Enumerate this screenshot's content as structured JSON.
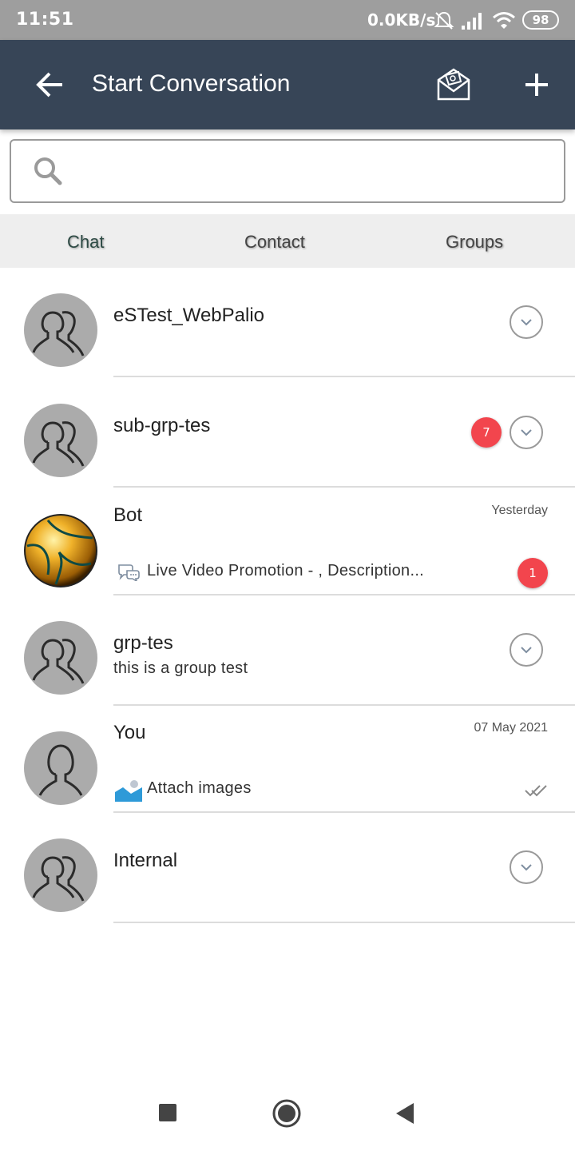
{
  "status_bar": {
    "time": "11:51",
    "network_speed": "0.0KB/s",
    "battery": "98",
    "icons": [
      "alarm-off-icon",
      "signal-icon",
      "wifi-icon",
      "battery-icon"
    ]
  },
  "app_bar": {
    "title": "Start Conversation",
    "background": "#374557",
    "icons": [
      "back-arrow-icon",
      "broadcast-mail-icon",
      "plus-icon"
    ]
  },
  "search": {
    "placeholder": "",
    "value": ""
  },
  "tabs": [
    {
      "label": "Chat",
      "active": true
    },
    {
      "label": "Contact",
      "active": false
    },
    {
      "label": "Groups",
      "active": false
    }
  ],
  "conversations": [
    {
      "name": "eSTest_WebPalio",
      "avatar": "group-avatar-icon",
      "has_menu": true
    },
    {
      "name": "sub-grp-tes",
      "avatar": "group-avatar-icon",
      "badge": "7",
      "has_menu": true
    },
    {
      "name": "Bot",
      "avatar": "golden-ball-avatar",
      "time": "Yesterday",
      "message": "Live Video Promotion - , Description...",
      "message_icon": "chat-bubbles-icon",
      "badge": "1"
    },
    {
      "name": "grp-tes",
      "avatar": "group-avatar-icon",
      "subtitle": "this is a group test",
      "has_menu": true
    },
    {
      "name": "You",
      "avatar": "person-avatar-icon",
      "time": "07 May 2021",
      "message": "Attach images",
      "message_icon": "image-icon",
      "status_icon": "double-check-icon"
    },
    {
      "name": "Internal",
      "avatar": "group-avatar-icon",
      "has_menu": true
    }
  ],
  "colors": {
    "badge": "#f2454d",
    "active_tab": "#2d4a44",
    "avatar_bg": "#ababab"
  },
  "nav_bar": {
    "icons": [
      "recents-icon",
      "home-icon",
      "back-icon"
    ]
  }
}
